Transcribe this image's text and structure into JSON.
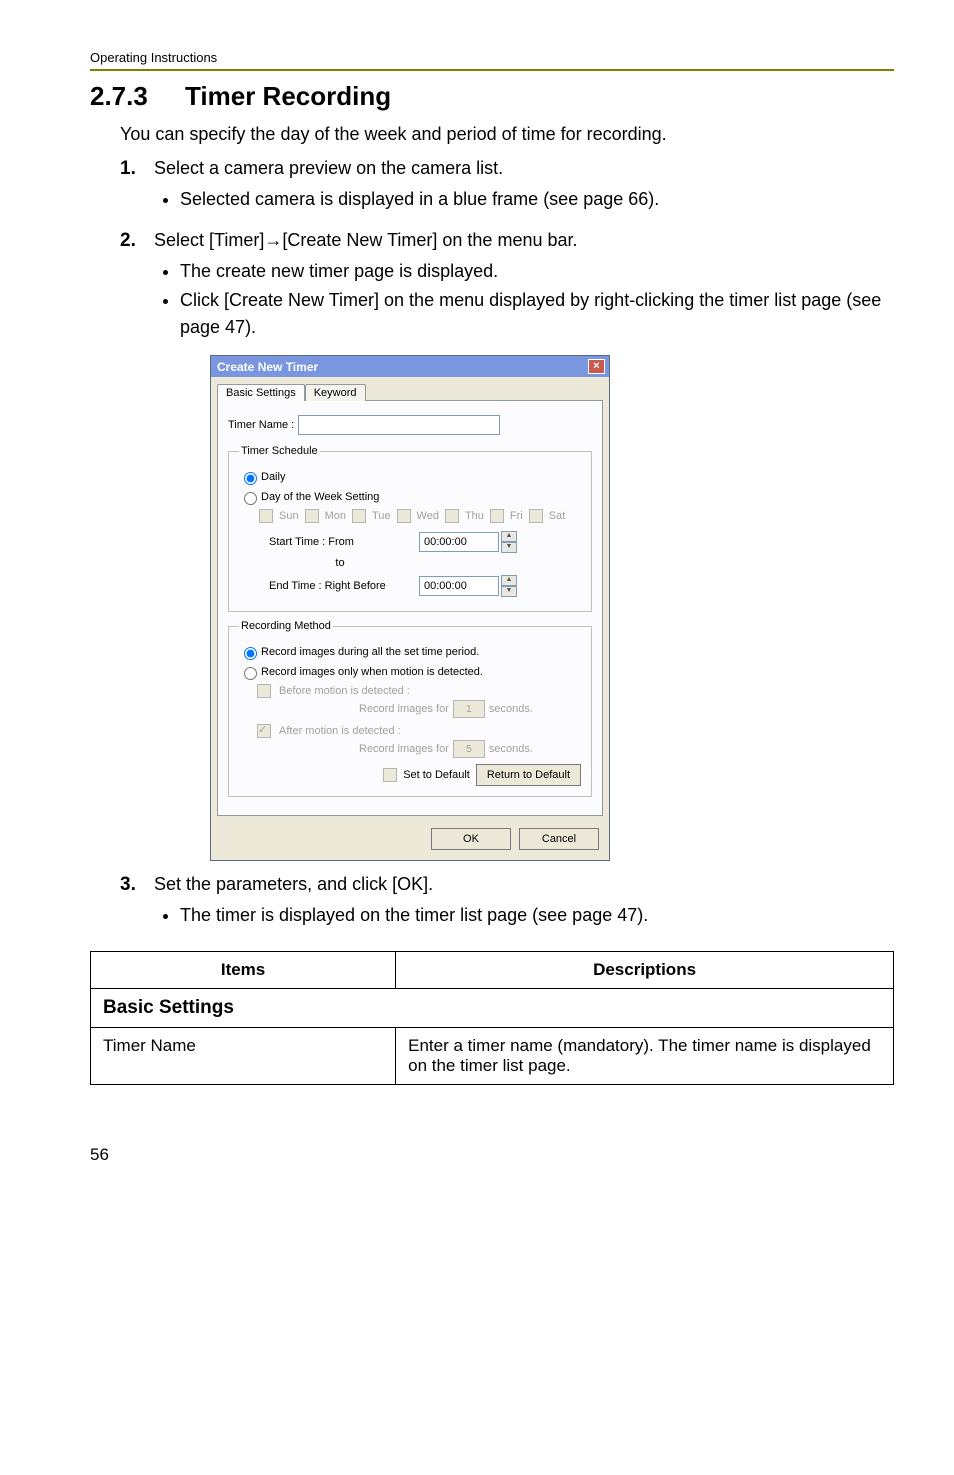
{
  "header": {
    "doc_title": "Operating Instructions"
  },
  "section": {
    "number": "2.7.3",
    "title": "Timer Recording"
  },
  "intro": "You can specify the day of the week and period of time for recording.",
  "steps": {
    "s1": {
      "num": "1.",
      "text": "Select a camera preview on the camera list.",
      "bullets": [
        "Selected camera is displayed in a blue frame (see page 66)."
      ]
    },
    "s2": {
      "num": "2.",
      "text_pre": "Select [Timer]",
      "text_post": "[Create New Timer] on the menu bar.",
      "bullets": [
        "The create new timer page is displayed.",
        "Click [Create New Timer] on the menu displayed by right-clicking the timer list page (see page 47)."
      ]
    },
    "s3": {
      "num": "3.",
      "text": "Set the parameters, and click [OK].",
      "bullets": [
        "The timer is displayed on the timer list page (see page 47)."
      ]
    }
  },
  "dialog": {
    "title": "Create New Timer",
    "tabs": {
      "basic": "Basic Settings",
      "keyword": "Keyword"
    },
    "timer_name_label": "Timer Name :",
    "groups": {
      "schedule": {
        "legend": "Timer Schedule"
      },
      "method": {
        "legend": "Recording Method"
      }
    },
    "schedule": {
      "daily": "Daily",
      "dow": "Day of the Week Setting",
      "days": {
        "sun": "Sun",
        "mon": "Mon",
        "tue": "Tue",
        "wed": "Wed",
        "thu": "Thu",
        "fri": "Fri",
        "sat": "Sat"
      },
      "start_label": "Start Time :   From",
      "start_value": "00:00:00",
      "to": "to",
      "end_label": "End Time :   Right Before",
      "end_value": "00:00:00"
    },
    "method": {
      "opt1": "Record images during all the set time period.",
      "opt2": "Record images only when motion is detected.",
      "before": "Before motion is detected :",
      "after": "After motion is detected :",
      "rec_for": "Record images for",
      "sec": "seconds.",
      "val_before": "1",
      "val_after": "5"
    },
    "defaults": {
      "set_label": "Set to Default",
      "return_btn": "Return to Default"
    },
    "buttons": {
      "ok": "OK",
      "cancel": "Cancel"
    }
  },
  "table": {
    "h_items": "Items",
    "h_desc": "Descriptions",
    "basic": "Basic Settings",
    "row1_item": "Timer Name",
    "row1_desc": "Enter a timer name (mandatory). The timer name is displayed on the timer list page."
  },
  "page_number": "56"
}
